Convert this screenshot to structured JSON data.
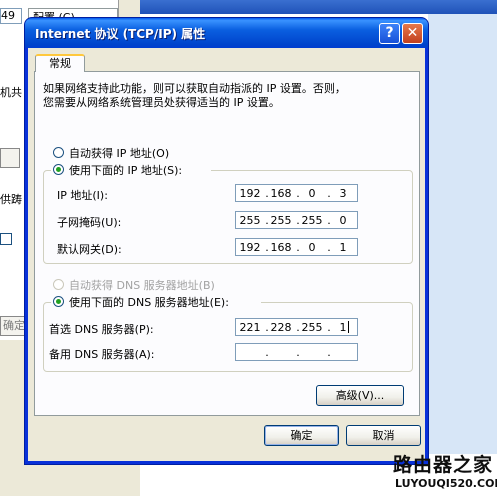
{
  "background": {
    "fragments": [
      "49",
      "配置 (C)",
      "机共",
      "供踌",
      "确定"
    ]
  },
  "dialog": {
    "title": "Internet 协议 (TCP/IP) 属性",
    "help_label": "?",
    "close_label": "✕",
    "tab_label": "常规",
    "description": "如果网络支持此功能，则可以获取自动指派的 IP 设置。否则，\n您需要从网络系统管理员处获得适当的 IP 设置。",
    "ip_auto_label": "自动获得 IP 地址(O)",
    "ip_manual_label": "使用下面的 IP 地址(S):",
    "ip_address_label": "IP 地址(I):",
    "subnet_label": "子网掩码(U):",
    "gateway_label": "默认网关(D):",
    "ip_address": [
      "192",
      "168",
      "0",
      "3"
    ],
    "subnet": [
      "255",
      "255",
      "255",
      "0"
    ],
    "gateway": [
      "192",
      "168",
      "0",
      "1"
    ],
    "dns_auto_label": "自动获得 DNS 服务器地址(B)",
    "dns_manual_label": "使用下面的 DNS 服务器地址(E):",
    "dns_preferred_label": "首选 DNS 服务器(P):",
    "dns_alternate_label": "备用 DNS 服务器(A):",
    "dns_preferred": [
      "221",
      "228",
      "255",
      "1"
    ],
    "dns_alternate": [
      "",
      "",
      "",
      ""
    ],
    "advanced_label": "高级(V)...",
    "ok_label": "确定",
    "cancel_label": "取消",
    "selected_ip_mode": "manual",
    "selected_dns_mode": "manual"
  },
  "watermark": {
    "logo": "路由器之家",
    "url": "LUYOUQI520.COM"
  },
  "colors": {
    "titlebar": "#0058ee",
    "radio_selected": "#21a121",
    "input_border": "#7f9db9"
  }
}
